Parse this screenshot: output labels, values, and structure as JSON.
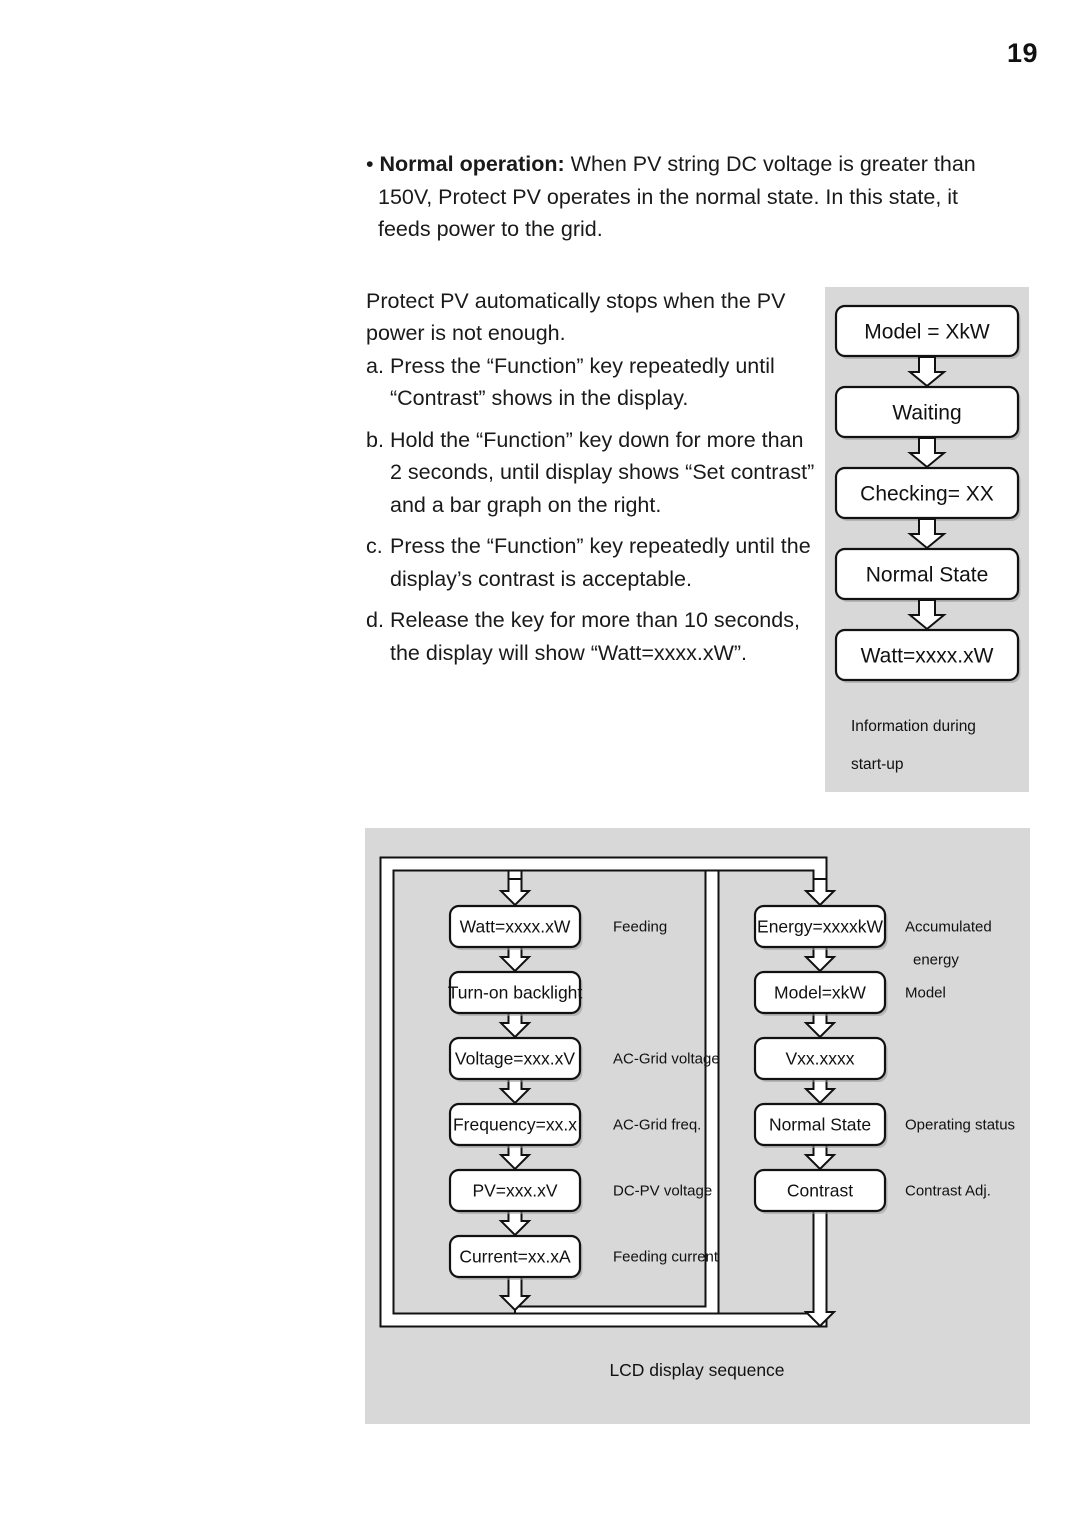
{
  "page": {
    "number": "19"
  },
  "body": {
    "bullet": {
      "lead": "Normal operation:",
      "text": " When PV string DC voltage is greater than 150V, Protect PV operates in the normal state. In this state, it feeds power to the grid."
    },
    "intro": "Protect PV automatically stops when the PV power is not enough.",
    "steps": [
      {
        "marker": "a.",
        "text": "Press the “Function” key repeatedly until “Contrast” shows in the display."
      },
      {
        "marker": "b.",
        "text": "Hold the “Function” key down for more than 2 seconds, until display shows “Set contrast” and a bar graph on the right."
      },
      {
        "marker": "c.",
        "text": "Press the “Function” key repeatedly until the display’s contrast is acceptable."
      },
      {
        "marker": "d.",
        "text": "Release the key for more than 10 seconds, the display will show “Watt=xxxx.xW”."
      }
    ]
  },
  "startup_diagram": {
    "caption_line1": "Information during",
    "caption_line2": "start-up",
    "nodes": [
      {
        "label": "Model = XkW"
      },
      {
        "label": "Waiting"
      },
      {
        "label": "Checking= XX"
      },
      {
        "label": "Normal State"
      },
      {
        "label": "Watt=xxxx.xW"
      }
    ]
  },
  "lcd_diagram": {
    "caption": "LCD display sequence",
    "left_column": [
      {
        "label": "Watt=xxxx.xW",
        "note": "Feeding"
      },
      {
        "label": "Turn-on backlight",
        "note": ""
      },
      {
        "label": "Voltage=xxx.xV",
        "note": "AC-Grid voltage"
      },
      {
        "label": "Frequency=xx.x",
        "note": "AC-Grid freq."
      },
      {
        "label": "PV=xxx.xV",
        "note": "DC-PV voltage"
      },
      {
        "label": "Current=xx.xA",
        "note": "Feeding current"
      }
    ],
    "right_column": [
      {
        "label": "Energy=xxxxkW",
        "note": "Accumulated",
        "note2": "energy"
      },
      {
        "label": "Model=xkW",
        "note": "Model",
        "note2": ""
      },
      {
        "label": "Vxx.xxxx",
        "note": "",
        "note2": ""
      },
      {
        "label": "Normal State",
        "note": "Operating status",
        "note2": ""
      },
      {
        "label": "Contrast",
        "note": "Contrast Adj.",
        "note2": ""
      }
    ]
  },
  "colors": {
    "panel_bg": "#d8d8d8",
    "node_fill": "#ffffff",
    "stroke": "#111111",
    "text": "#1a1a1a"
  }
}
